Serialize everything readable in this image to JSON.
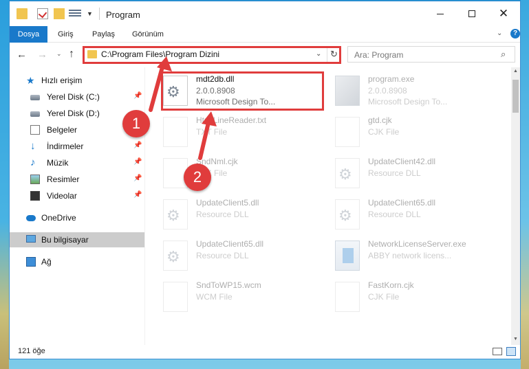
{
  "window": {
    "title": "Program"
  },
  "ribbon": {
    "tabs": [
      "Dosya",
      "Giriş",
      "Paylaş",
      "Görünüm"
    ]
  },
  "address": {
    "path": "C:\\Program Files\\Program Dizini"
  },
  "search": {
    "placeholder": "Ara: Program"
  },
  "sidebar": {
    "items": [
      {
        "label": "Hızlı erişim",
        "icon": "star-icon"
      },
      {
        "label": "Yerel Disk (C:)",
        "icon": "drive-icon"
      },
      {
        "label": "Yerel Disk (D:)",
        "icon": "drive-icon"
      },
      {
        "label": "Belgeler",
        "icon": "document-icon"
      },
      {
        "label": "İndirmeler",
        "icon": "download-icon"
      },
      {
        "label": "Müzik",
        "icon": "music-icon"
      },
      {
        "label": "Resimler",
        "icon": "picture-icon"
      },
      {
        "label": "Videolar",
        "icon": "video-icon"
      },
      {
        "label": "OneDrive",
        "icon": "cloud-icon"
      },
      {
        "label": "Bu bilgisayar",
        "icon": "computer-icon"
      },
      {
        "label": "Ağ",
        "icon": "network-icon"
      }
    ]
  },
  "files": [
    {
      "name": "mdt2db.dll",
      "line2": "2.0.0.8908",
      "line3": "Microsoft Design To..."
    },
    {
      "name": "program.exe",
      "line2": "2.0.0.8908",
      "line3": "Microsoft Design To..."
    },
    {
      "name": "HtmlLineReader.txt",
      "line2": "TXT File",
      "line3": ""
    },
    {
      "name": "gtd.cjk",
      "line2": "CJK File",
      "line3": ""
    },
    {
      "name": "SndNml.cjk",
      "line2": "CJK File",
      "line3": ""
    },
    {
      "name": "UpdateClient42.dll",
      "line2": "Resource DLL",
      "line3": ""
    },
    {
      "name": "UpdateClient5.dll",
      "line2": "Resource DLL",
      "line3": ""
    },
    {
      "name": "UpdateClient65.dll",
      "line2": "Resource DLL",
      "line3": ""
    },
    {
      "name": "UpdateClient65.dll",
      "line2": "Resource DLL",
      "line3": ""
    },
    {
      "name": "NetworkLicenseServer.exe",
      "line2": "ABBY network licens...",
      "line3": ""
    },
    {
      "name": "SndToWP15.wcm",
      "line2": "WCM File",
      "line3": ""
    },
    {
      "name": "FastKorn.cjk",
      "line2": "CJK File",
      "line3": ""
    }
  ],
  "status": {
    "count": "121 öğe"
  },
  "annotations": {
    "step1": "1",
    "step2": "2",
    "color": "#e03c3c"
  }
}
